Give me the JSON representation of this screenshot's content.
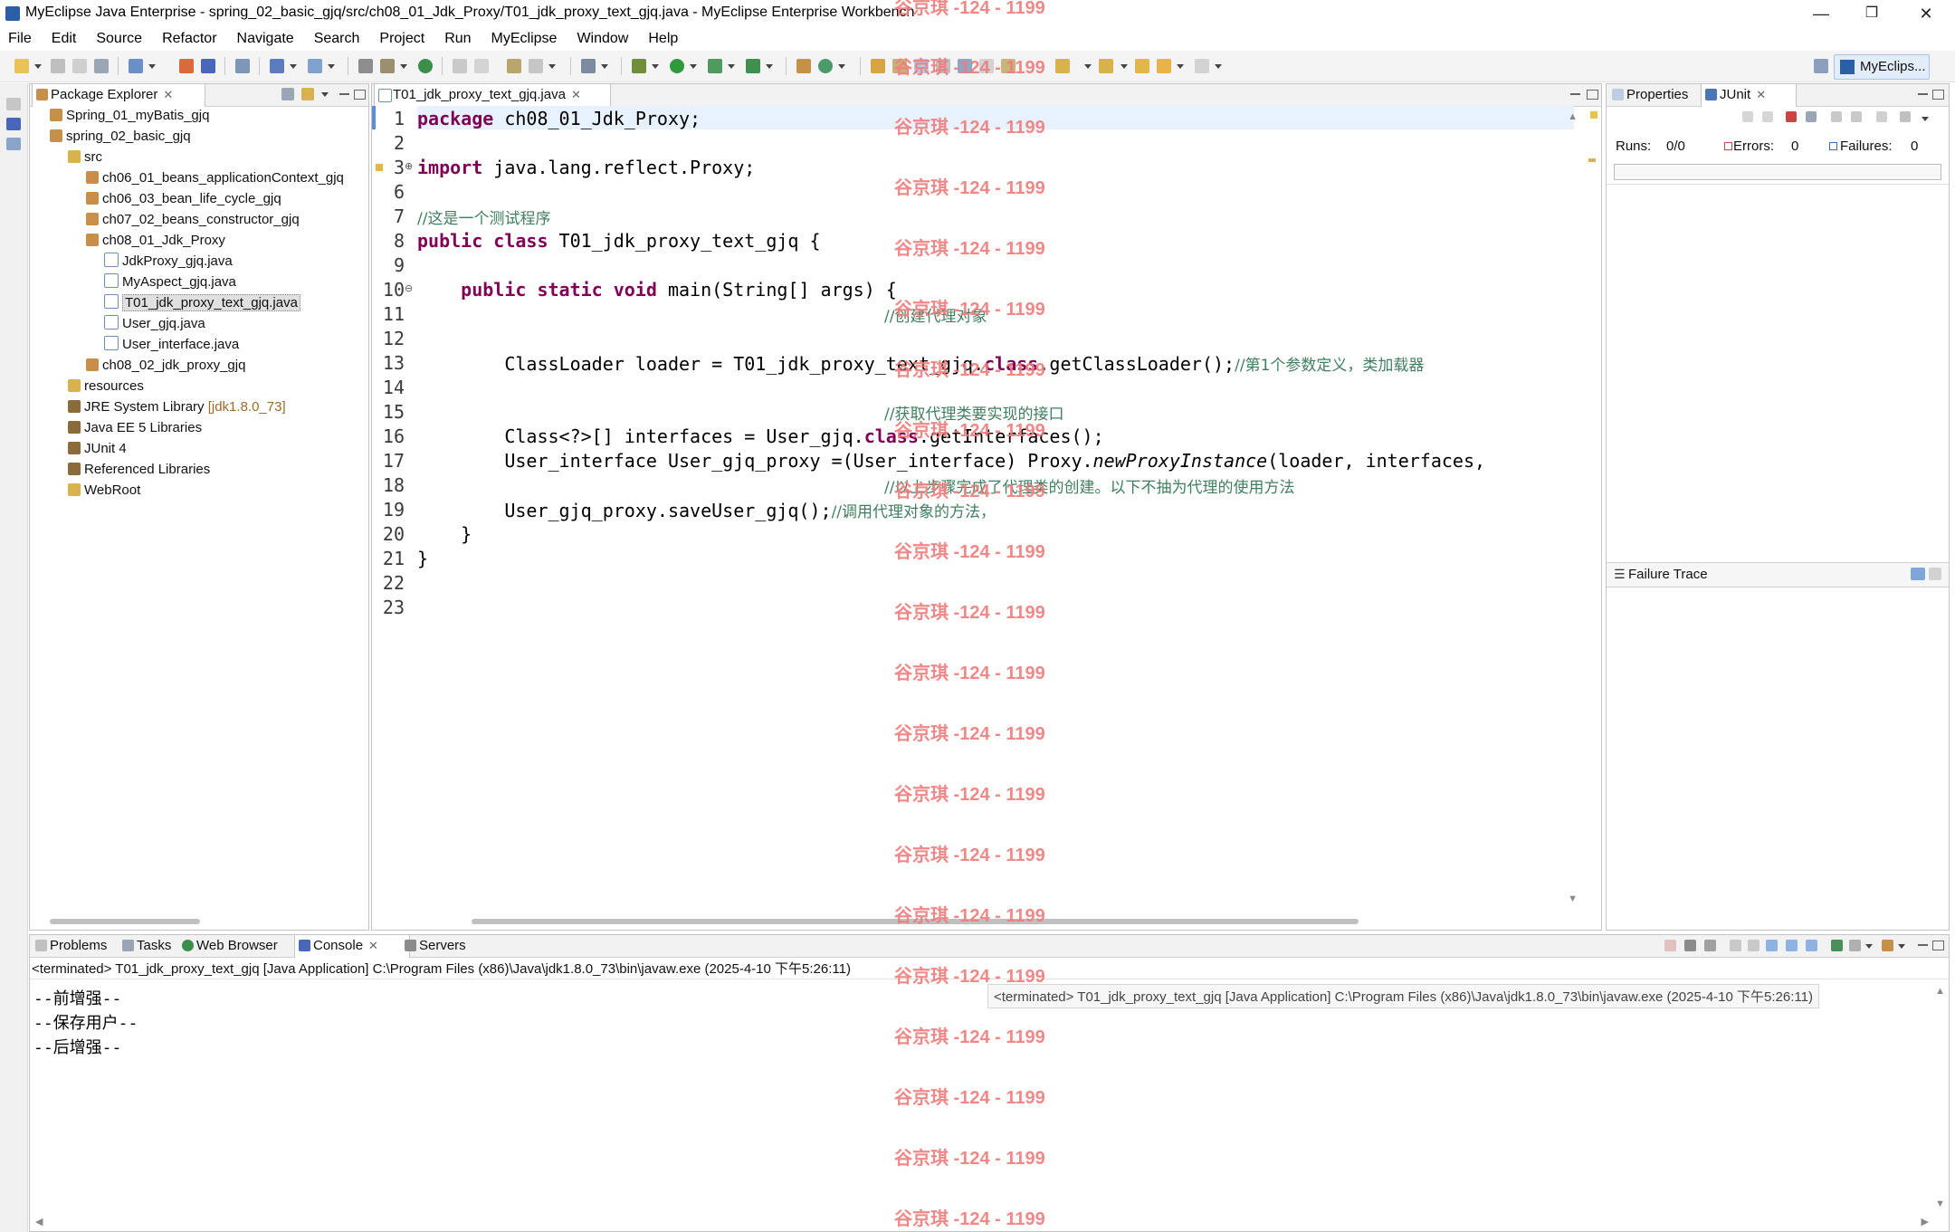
{
  "window": {
    "title": "MyEclipse Java Enterprise - spring_02_basic_gjq/src/ch08_01_Jdk_Proxy/T01_jdk_proxy_text_gjq.java - MyEclipse Enterprise Workbench",
    "minimize": "—",
    "maximize": "❐",
    "close": "✕"
  },
  "menu": [
    "File",
    "Edit",
    "Source",
    "Refactor",
    "Navigate",
    "Search",
    "Project",
    "Run",
    "MyEclipse",
    "Window",
    "Help"
  ],
  "toolbar": {
    "perspective_label": "MyEclips..."
  },
  "package_explorer": {
    "tab_label": "Package Explorer",
    "close": "✕",
    "items": [
      "Spring_01_myBatis_gjq",
      "spring_02_basic_gjq",
      "src",
      "ch06_01_beans_applicationContext_gjq",
      "ch06_03_bean_life_cycle_gjq",
      "ch07_02_beans_constructor_gjq",
      "ch08_01_Jdk_Proxy",
      "JdkProxy_gjq.java",
      "MyAspect_gjq.java",
      "T01_jdk_proxy_text_gjq.java",
      "User_gjq.java",
      "User_interface.java",
      "ch08_02_jdk_proxy_gjq",
      "resources",
      "JRE System Library",
      "Java EE 5 Libraries",
      "JUnit 4",
      "Referenced Libraries",
      "WebRoot"
    ],
    "jre_version": "[jdk1.8.0_73]"
  },
  "editor": {
    "tab_label": "T01_jdk_proxy_text_gjq.java",
    "close": "✕",
    "line_numbers": [
      "1",
      "2",
      "3",
      "6",
      "7",
      "8",
      "9",
      "10",
      "11",
      "12",
      "13",
      "14",
      "15",
      "16",
      "17",
      "18",
      "19",
      "20",
      "21",
      "22",
      "23"
    ],
    "code": {
      "l1_kw": "package",
      "l1_rest": " ch08_01_Jdk_Proxy;",
      "l3_kw": "import",
      "l3_rest": " java.lang.reflect.Proxy;",
      "l7_cm": "//这是一个测试程序",
      "l8_kw": "public class",
      "l8_rest": " T01_jdk_proxy_text_gjq {",
      "l10_indent": "    ",
      "l10_kw": "public static void",
      "l10_rest": " main(String[] args) {",
      "l11_cm": "//创建代理对象",
      "l13_a": "        ClassLoader loader = T01_jdk_proxy_text_gjq.",
      "l13_kw": "class",
      "l13_b": ".getClassLoader();",
      "l13_cm": "//第1个参数定义，类加载器",
      "l15_cm": "//获取代理类要实现的接口",
      "l16_a": "        Class<?>[] interfaces = User_gjq.",
      "l16_kw": "class",
      "l16_b": ".getInterfaces();",
      "l17_a": "        User_interface User_gjq_proxy =(User_interface) Proxy.",
      "l17_it": "newProxyInstance",
      "l17_b": "(loader, interfaces,",
      "l18_cm": "//以上步骤完成了代理类的创建。以下不抽为代理的使用方法",
      "l19_a": "        User_gjq_proxy.saveUser_gjq();",
      "l19_cm": "//调用代理对象的方法，",
      "l20": "    }",
      "l21": "}"
    }
  },
  "right_panel": {
    "tab_properties": "Properties",
    "tab_junit": "JUnit",
    "close": "✕",
    "runs_label": "Runs:",
    "runs_value": "0/0",
    "errors_label": "Errors:",
    "errors_value": "0",
    "failures_label": "Failures:",
    "failures_value": "0",
    "failure_trace": "Failure Trace"
  },
  "bottom_panel": {
    "tabs": [
      "Problems",
      "Tasks",
      "Web Browser",
      "Console",
      "Servers"
    ],
    "close": "✕",
    "console_header": "<terminated> T01_jdk_proxy_text_gjq [Java Application] C:\\Program Files (x86)\\Java\\jdk1.8.0_73\\bin\\javaw.exe (2025-4-10 下午5:26:11)",
    "console_tooltip": "<terminated> T01_jdk_proxy_text_gjq [Java Application] C:\\Program Files (x86)\\Java\\jdk1.8.0_73\\bin\\javaw.exe (2025-4-10 下午5:26:11)",
    "output": [
      "--前增强--",
      "--保存用户--",
      "--后增强--"
    ]
  },
  "watermark": "谷京琪 -124 - 1199",
  "colors": {
    "keyword": "#7f0055",
    "comment": "#3f7f5f",
    "watermark": "#f07c7c"
  }
}
